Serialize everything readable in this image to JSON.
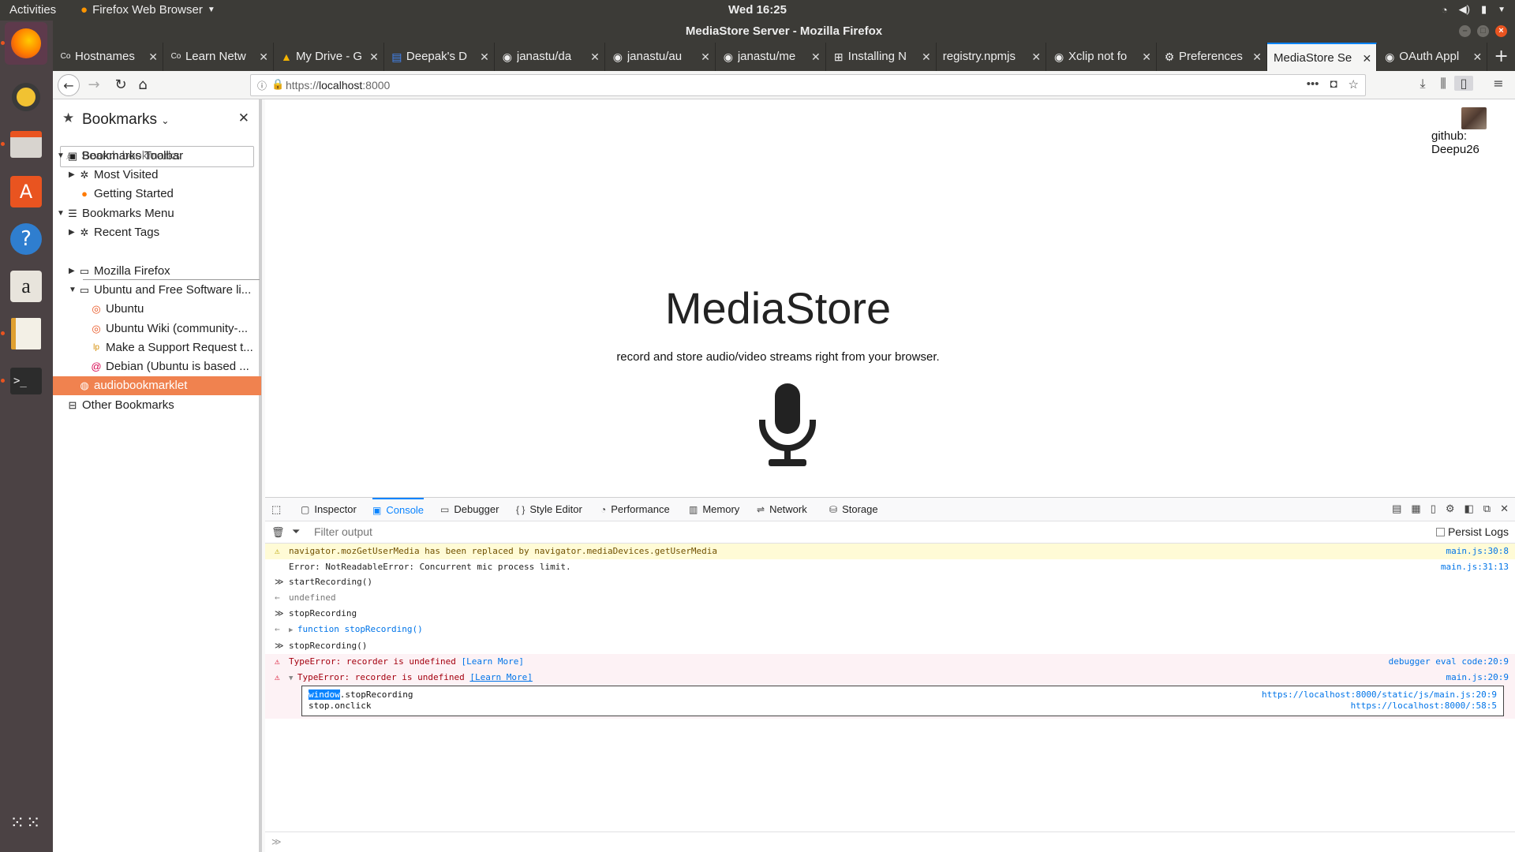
{
  "topbar": {
    "activities": "Activities",
    "app_name": "Firefox Web Browser",
    "clock": "Wed 16:25"
  },
  "window": {
    "title": "MediaStore Server - Mozilla Firefox"
  },
  "tabs": [
    {
      "label": "Hostnames",
      "icon": "codeanywhere-icon"
    },
    {
      "label": "Learn Netw",
      "icon": "codeanywhere-icon"
    },
    {
      "label": "My Drive - G",
      "icon": "drive-icon"
    },
    {
      "label": "Deepak's D",
      "icon": "docs-icon"
    },
    {
      "label": "janastu/da",
      "icon": "github-icon"
    },
    {
      "label": "janastu/au",
      "icon": "github-icon"
    },
    {
      "label": "janastu/me",
      "icon": "github-icon"
    },
    {
      "label": "Installing N",
      "icon": "page-icon"
    },
    {
      "label": "registry.npmjs",
      "icon": "none"
    },
    {
      "label": "Xclip not fo",
      "icon": "github-icon"
    },
    {
      "label": "Preferences",
      "icon": "gear-icon"
    },
    {
      "label": "MediaStore Se",
      "icon": "none",
      "selected": true
    },
    {
      "label": "OAuth Appl",
      "icon": "github-icon"
    }
  ],
  "navbar": {
    "url_prefix": "https://",
    "url_host": "localhost",
    "url_port": ":8000"
  },
  "sidebar": {
    "title": "Bookmarks",
    "search_placeholder": "Search bookmarks",
    "tree": [
      {
        "label": "Bookmarks Toolbar",
        "level": 0,
        "twisty": "open",
        "icon": "toolbar-icon"
      },
      {
        "label": "Most Visited",
        "level": 1,
        "twisty": "closed",
        "icon": "gear-icon"
      },
      {
        "label": "Getting Started",
        "level": 1,
        "twisty": "none",
        "icon": "firefox-icon"
      },
      {
        "label": "Bookmarks Menu",
        "level": 0,
        "twisty": "open",
        "icon": "menu-icon"
      },
      {
        "label": "Recent Tags",
        "level": 1,
        "twisty": "closed",
        "icon": "gear-icon"
      },
      {
        "label": "Mozilla Firefox",
        "level": 1,
        "twisty": "closed",
        "icon": "folder-icon"
      },
      {
        "label": "Ubuntu and Free Software li...",
        "level": 1,
        "twisty": "open",
        "icon": "folder-icon"
      },
      {
        "label": "Ubuntu",
        "level": 2,
        "twisty": "none",
        "icon": "ubuntu-icon"
      },
      {
        "label": "Ubuntu Wiki (community-...",
        "level": 2,
        "twisty": "none",
        "icon": "ubuntu-icon"
      },
      {
        "label": "Make a Support Request t...",
        "level": 2,
        "twisty": "none",
        "icon": "launchpad-icon"
      },
      {
        "label": "Debian (Ubuntu is based ...",
        "level": 2,
        "twisty": "none",
        "icon": "debian-icon"
      },
      {
        "label": "audiobookmarklet",
        "level": 1,
        "twisty": "none",
        "icon": "globe-icon",
        "selected": true
      },
      {
        "label": "Other Bookmarks",
        "level": 0,
        "twisty": "none",
        "icon": "inbox-icon"
      }
    ]
  },
  "page": {
    "github_label": "github: Deepu26",
    "heading": "MediaStore",
    "tagline": "record and store audio/video streams right from your browser."
  },
  "devtools": {
    "tabs": [
      {
        "label": "Inspector",
        "icon": "inspector-icon"
      },
      {
        "label": "Console",
        "icon": "console-icon",
        "selected": true
      },
      {
        "label": "Debugger",
        "icon": "debugger-icon"
      },
      {
        "label": "Style Editor",
        "icon": "braces-icon"
      },
      {
        "label": "Performance",
        "icon": "gauge-icon"
      },
      {
        "label": "Memory",
        "icon": "memory-icon"
      },
      {
        "label": "Network",
        "icon": "network-icon"
      },
      {
        "label": "Storage",
        "icon": "storage-icon"
      }
    ],
    "filter_placeholder": "Filter output",
    "persist_logs": "Persist Logs",
    "messages": [
      {
        "kind": "warn",
        "text": "navigator.mozGetUserMedia has been replaced by navigator.mediaDevices.getUserMedia",
        "location": "main.js:30:8"
      },
      {
        "kind": "log",
        "text": "Error: NotReadableError: Concurrent mic process limit.",
        "location": "main.js:31:13"
      },
      {
        "kind": "in",
        "text": "startRecording()",
        "location": ""
      },
      {
        "kind": "out",
        "text": "undefined",
        "location": ""
      },
      {
        "kind": "in",
        "text": "stopRecording",
        "location": ""
      },
      {
        "kind": "out-fn",
        "text": "function stopRecording()",
        "location": ""
      },
      {
        "kind": "in",
        "text": "stopRecording()",
        "location": ""
      },
      {
        "kind": "err",
        "text": "TypeError: recorder is undefined",
        "link": "[Learn More]",
        "location": "debugger eval code:20:9"
      },
      {
        "kind": "err-open",
        "text": "TypeError: recorder is undefined",
        "link": "[Learn More]",
        "location": "main.js:20:9"
      }
    ],
    "stack": [
      {
        "obj": "window",
        "fn": ".stopRecording",
        "location": "https://localhost:8000/static/js/main.js:20:9"
      },
      {
        "obj": "",
        "fn": "stop.onclick",
        "location": "https://localhost:8000/:58:5"
      }
    ]
  },
  "colors": {
    "accent": "#0a84ff",
    "ubuntu_orange": "#e95420",
    "selection": "#f0824f",
    "error": "#d70022"
  }
}
